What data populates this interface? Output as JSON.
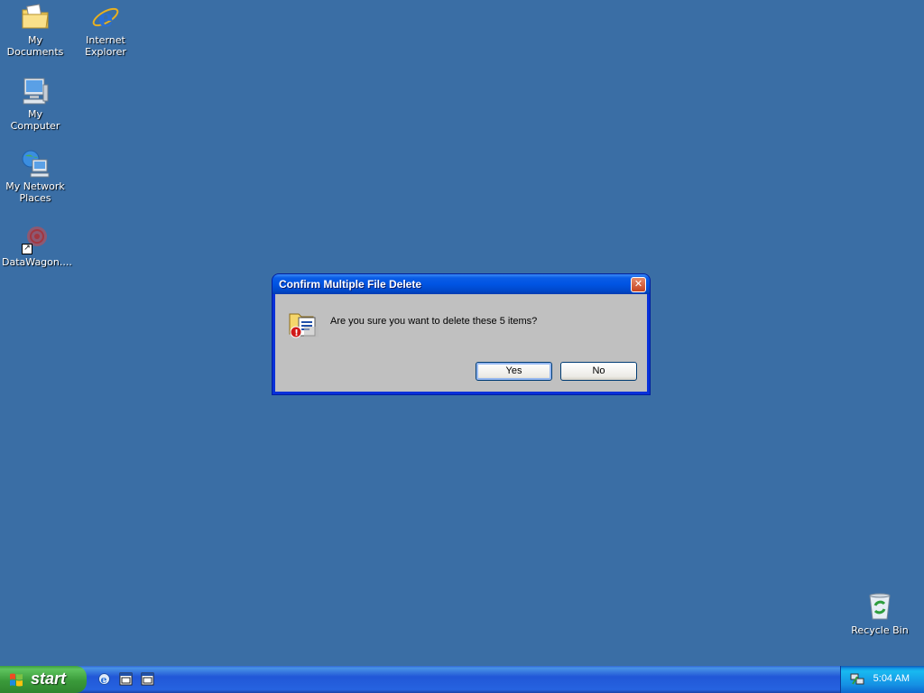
{
  "desktop": {
    "background_color": "#3a6ea5",
    "icons": [
      {
        "label": "My Documents",
        "icon": "folder-documents-icon"
      },
      {
        "label": "Internet\nExplorer",
        "icon": "internet-explorer-icon"
      },
      {
        "label": "My Computer",
        "icon": "computer-icon"
      },
      {
        "label": "My Network\nPlaces",
        "icon": "network-places-icon"
      },
      {
        "label": "DataWagon....",
        "icon": "datawagon-shortcut-icon"
      },
      {
        "label": "Recycle Bin",
        "icon": "recycle-bin-icon"
      }
    ]
  },
  "dialog": {
    "title": "Confirm Multiple File Delete",
    "message": "Are you sure you want to delete these 5 items?",
    "yes_label": "Yes",
    "no_label": "No",
    "icon": "delete-files-warning-icon"
  },
  "taskbar": {
    "start_label": "start",
    "quick_launch": [
      "internet-explorer-icon",
      "window-icon",
      "window-icon"
    ],
    "clock": "5:04 AM",
    "tray_icon": "network-tray-icon"
  }
}
